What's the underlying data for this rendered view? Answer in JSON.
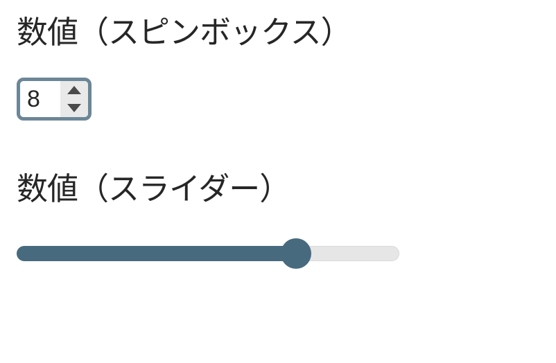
{
  "spinbox": {
    "label": "数値（スピンボックス）",
    "value": "8"
  },
  "slider": {
    "label": "数値（スライダー）",
    "percent": 73
  },
  "colors": {
    "accent": "#486a7f",
    "border": "#6b8697",
    "stepper_bg": "#e9e9e9",
    "track_bg": "#e6e6e6"
  }
}
